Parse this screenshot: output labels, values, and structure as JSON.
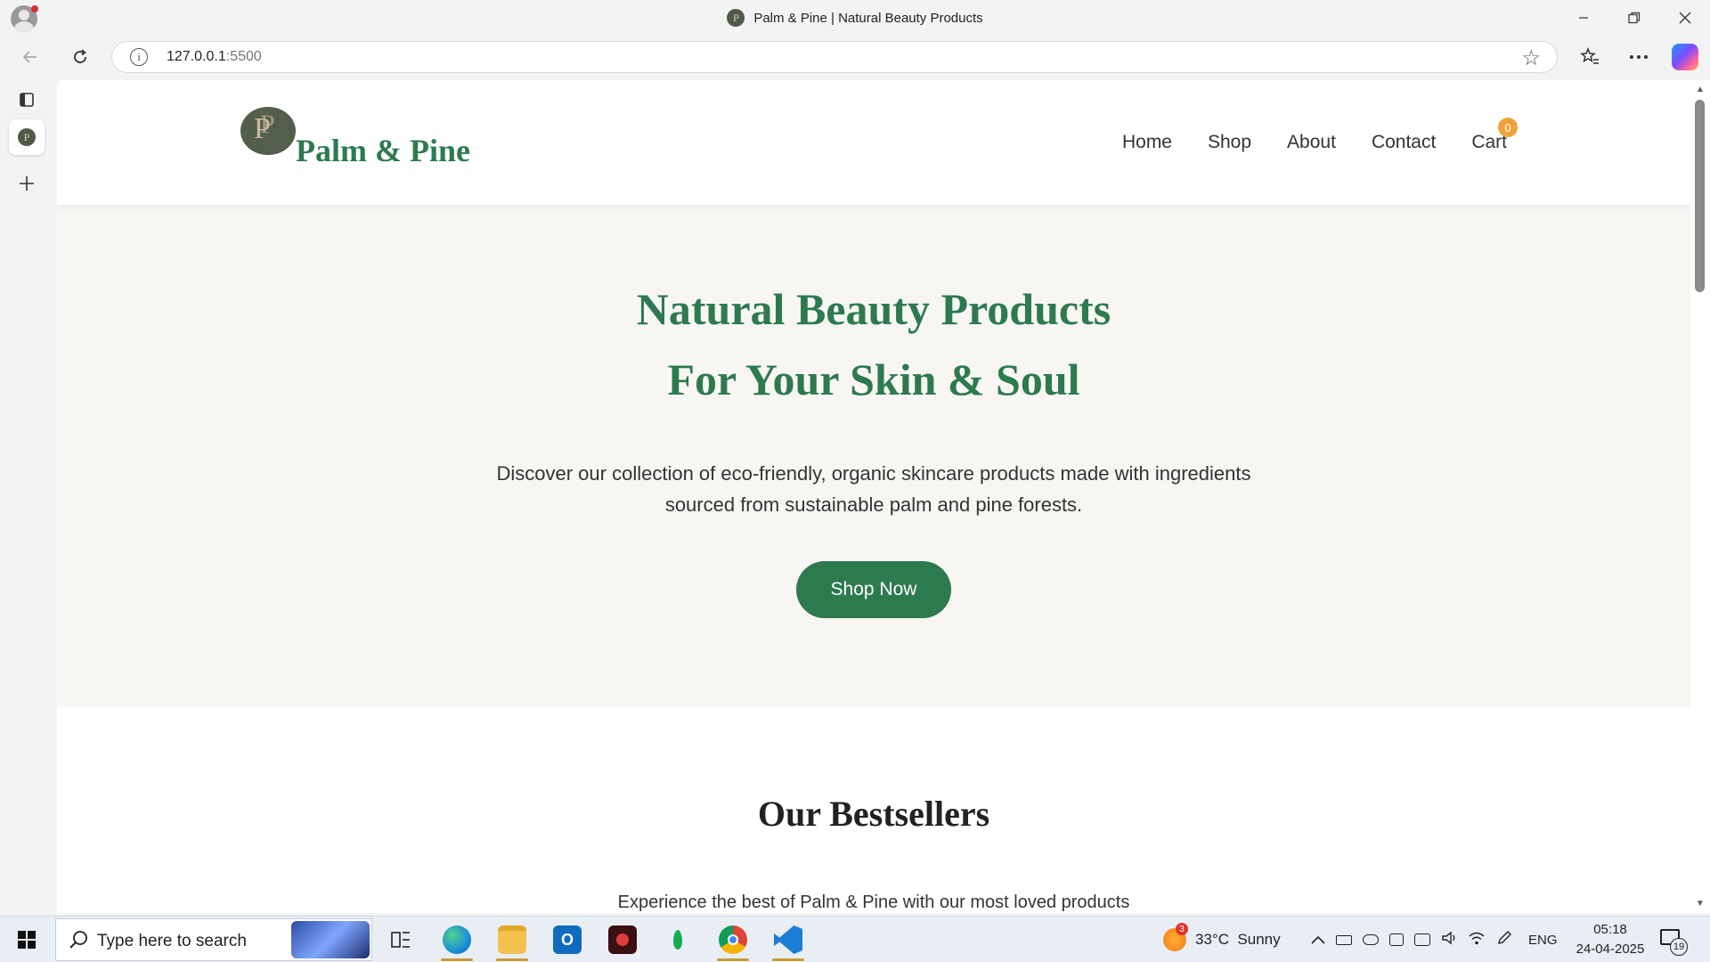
{
  "browser": {
    "tab_title": "Palm & Pine | Natural Beauty Products",
    "url_host": "127.0.0.1",
    "url_port": ":5500",
    "favicon_letter": "P"
  },
  "site": {
    "logo_letter": "P",
    "brand_name": "Palm & Pine",
    "nav": [
      {
        "label": "Home"
      },
      {
        "label": "Shop"
      },
      {
        "label": "About"
      },
      {
        "label": "Contact"
      },
      {
        "label": "Cart"
      }
    ],
    "cart_count": "0",
    "hero": {
      "title_line1": "Natural Beauty Products",
      "title_line2": "For Your Skin & Soul",
      "desc_line1": "Discover our collection of eco-friendly, organic skincare products made with ingredients",
      "desc_line2": "sourced from sustainable palm and pine forests.",
      "cta": "Shop Now"
    },
    "bestsellers": {
      "title": "Our Bestsellers",
      "subtitle": "Experience the best of Palm & Pine with our most loved products"
    }
  },
  "colors": {
    "brand_green": "#2d7a4f",
    "cart_badge": "#f0a23a",
    "hero_bg": "#f7f6f3"
  },
  "taskbar": {
    "search_placeholder": "Type here to search",
    "weather_badge": "3",
    "weather": "33°C  Sunny",
    "language": "ENG",
    "time": "05:18",
    "date": "24-04-2025",
    "notification_count": "19",
    "apps": [
      {
        "name": "task-view-icon"
      },
      {
        "name": "edge-icon"
      },
      {
        "name": "file-explorer-icon"
      },
      {
        "name": "outlook-icon"
      },
      {
        "name": "recorder-icon"
      },
      {
        "name": "mongodb-icon"
      },
      {
        "name": "chrome-icon"
      },
      {
        "name": "vscode-icon"
      }
    ]
  }
}
